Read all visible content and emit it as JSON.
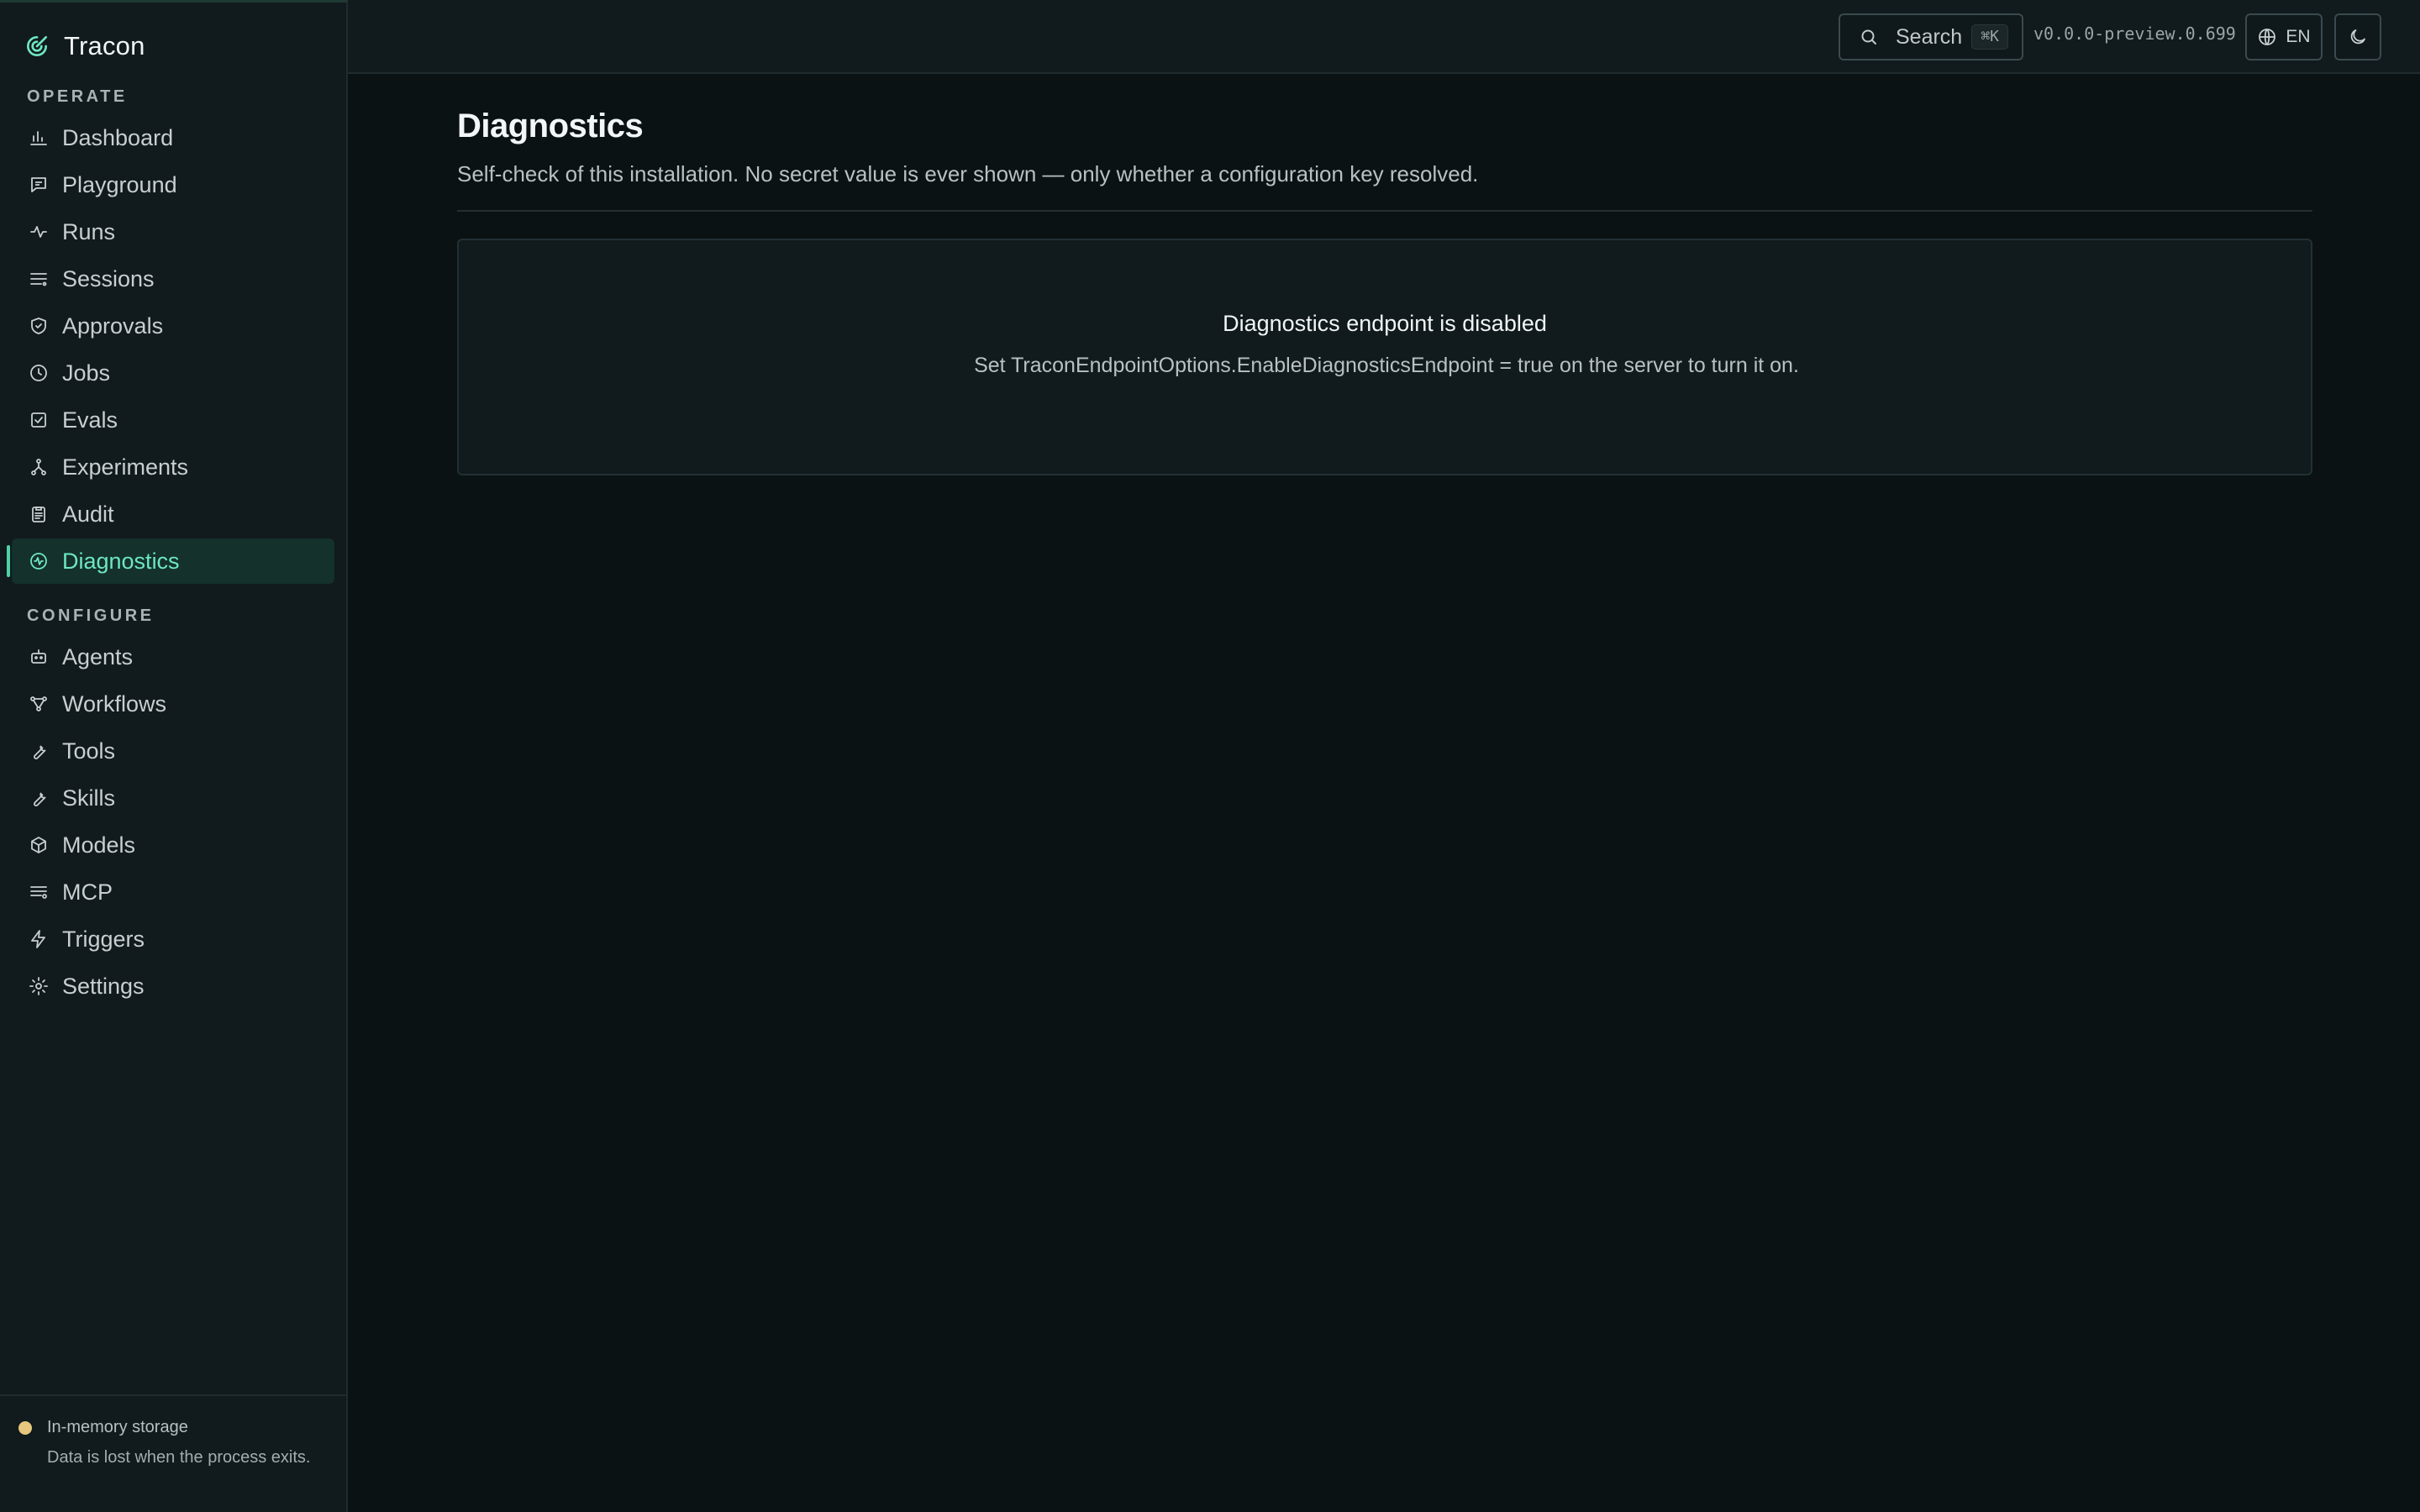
{
  "app": {
    "name": "Tracon"
  },
  "sidebar": {
    "operate_label": "OPERATE",
    "configure_label": "CONFIGURE",
    "operate_items": [
      {
        "label": "Dashboard",
        "icon": "bar-chart-icon"
      },
      {
        "label": "Playground",
        "icon": "chat-icon"
      },
      {
        "label": "Runs",
        "icon": "activity-icon"
      },
      {
        "label": "Sessions",
        "icon": "list-icon"
      },
      {
        "label": "Approvals",
        "icon": "shield-check-icon"
      },
      {
        "label": "Jobs",
        "icon": "clock-icon"
      },
      {
        "label": "Evals",
        "icon": "checkbox-icon"
      },
      {
        "label": "Experiments",
        "icon": "branch-icon"
      },
      {
        "label": "Audit",
        "icon": "clipboard-icon"
      },
      {
        "label": "Diagnostics",
        "icon": "diagnostics-icon",
        "active": true
      }
    ],
    "configure_items": [
      {
        "label": "Agents",
        "icon": "bot-icon"
      },
      {
        "label": "Workflows",
        "icon": "workflow-icon"
      },
      {
        "label": "Tools",
        "icon": "wrench-icon"
      },
      {
        "label": "Skills",
        "icon": "wrench-icon"
      },
      {
        "label": "Models",
        "icon": "cube-icon"
      },
      {
        "label": "MCP",
        "icon": "server-list-icon"
      },
      {
        "label": "Triggers",
        "icon": "zap-icon"
      },
      {
        "label": "Settings",
        "icon": "gear-icon"
      }
    ],
    "storage": {
      "title": "In-memory storage",
      "description": "Data is lost when the process exits."
    }
  },
  "topbar": {
    "search_label": "Search",
    "search_shortcut": "⌘K",
    "version": "v0.0.0-preview.0.699",
    "language": "EN"
  },
  "main": {
    "title": "Diagnostics",
    "subtitle": "Self-check of this installation. No secret value is ever shown — only whether a configuration key resolved.",
    "card": {
      "title": "Diagnostics endpoint is disabled",
      "description": "Set TraconEndpointOptions.EnableDiagnosticsEndpoint = true on the server to turn it on."
    }
  },
  "colors": {
    "accent": "#6ee7c1",
    "background": "#0a1214",
    "sidebar": "#111a1d",
    "warning_dot": "#e7c77d"
  }
}
